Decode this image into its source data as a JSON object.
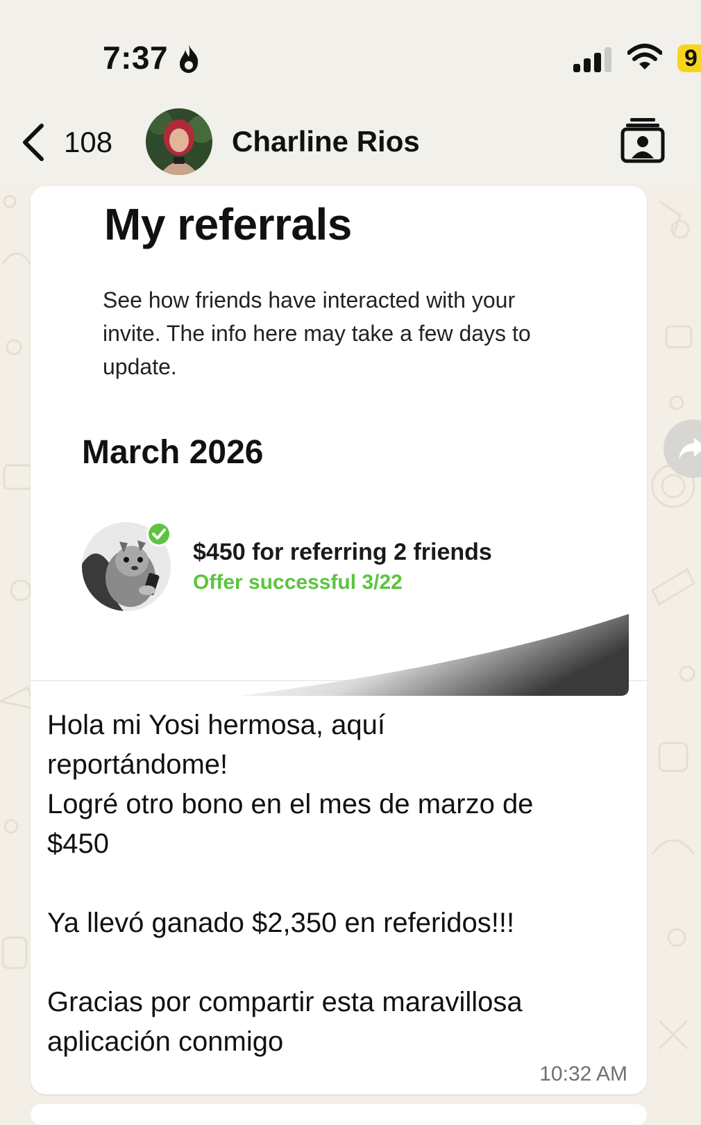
{
  "status_bar": {
    "time": "7:37",
    "battery_level": "9"
  },
  "header": {
    "back_count": "108",
    "contact_name": "Charline Rios"
  },
  "shared_image": {
    "title": "My referrals",
    "description": "See how friends have interacted with your\ninvite. The info here may take a few days to\nupdate.",
    "month": "March 2026",
    "referral": {
      "amount_text": "$450 for referring 2 friends",
      "status_text": "Offer successful 3/22",
      "status_color": "#5cc43f"
    }
  },
  "message": {
    "text": "Hola mi Yosi hermosa, aquí\nreportándome!\nLogré otro bono en el mes de marzo de\n$450\n\nYa llevó ganado $2,350 en referidos!!!\n\nGracias por compartir esta maravillosa\naplicación conmigo",
    "time": "10:32 AM"
  },
  "colors": {
    "background": "#f3efe6",
    "bubble": "#ffffff",
    "battery_badge": "#f7d51e",
    "check_green": "#5cc43f"
  }
}
